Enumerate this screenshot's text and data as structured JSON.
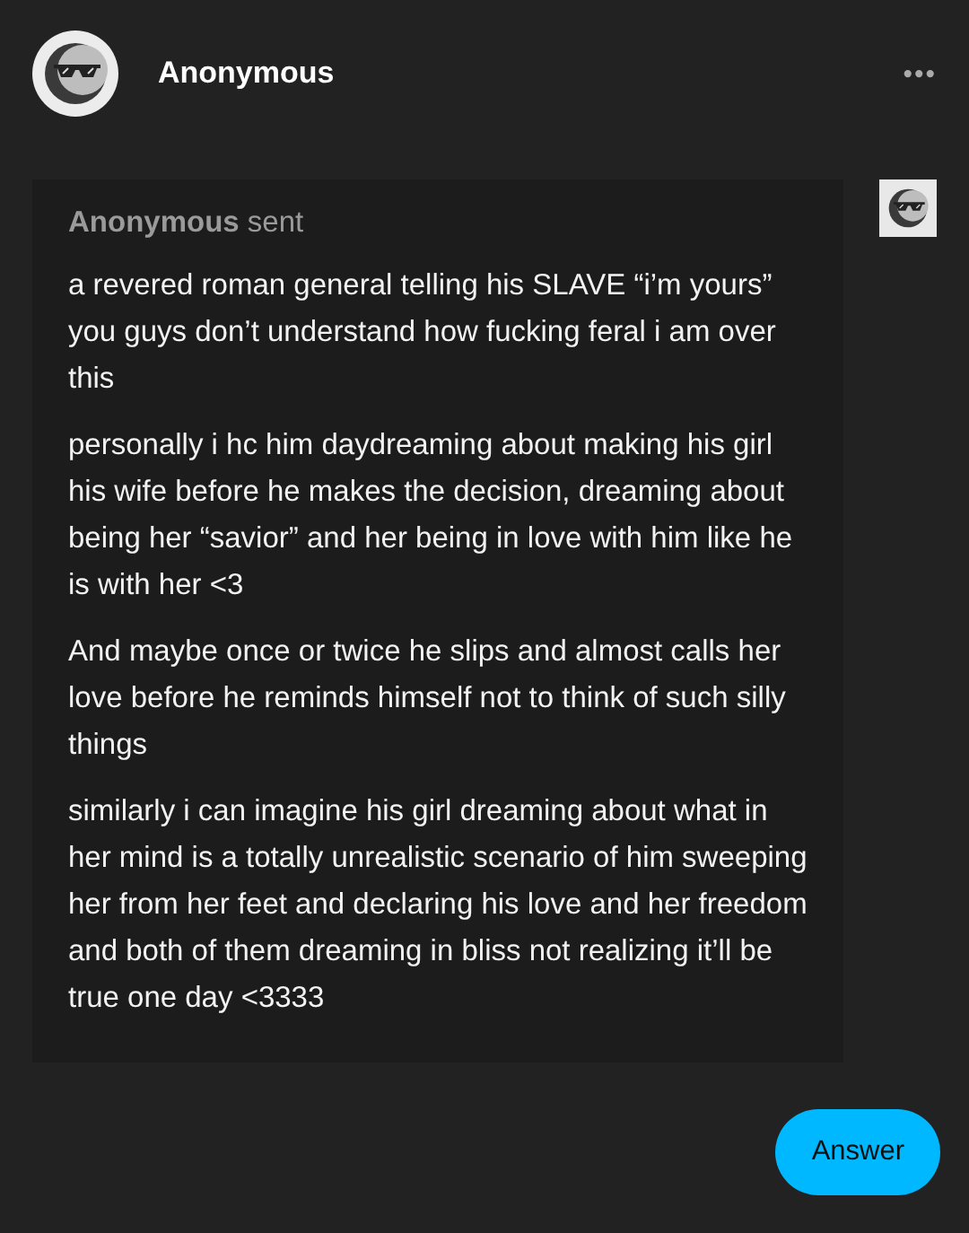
{
  "header": {
    "name": "Anonymous",
    "menu": "•••"
  },
  "ask": {
    "sender": "**Anonymous** sent",
    "paragraphs": [
      "a revered roman general telling his SLAVE “i’m yours” you guys don’t understand how fucking feral i am over this",
      "personally i hc him daydreaming about making his girl his wife before he makes the decision, dreaming about being her “savior” and her being in love with him like he is with her <3",
      "And maybe once or twice he slips and almost calls her love before he reminds himself not to think of such silly things",
      "similarly i can imagine his girl dreaming about what in her mind is a totally unrealistic scenario of him sweeping her from her feet and declaring his love and her freedom and both of them dreaming in bliss not realizing it’ll be true one day <3333"
    ]
  },
  "answer_button": "Answer"
}
